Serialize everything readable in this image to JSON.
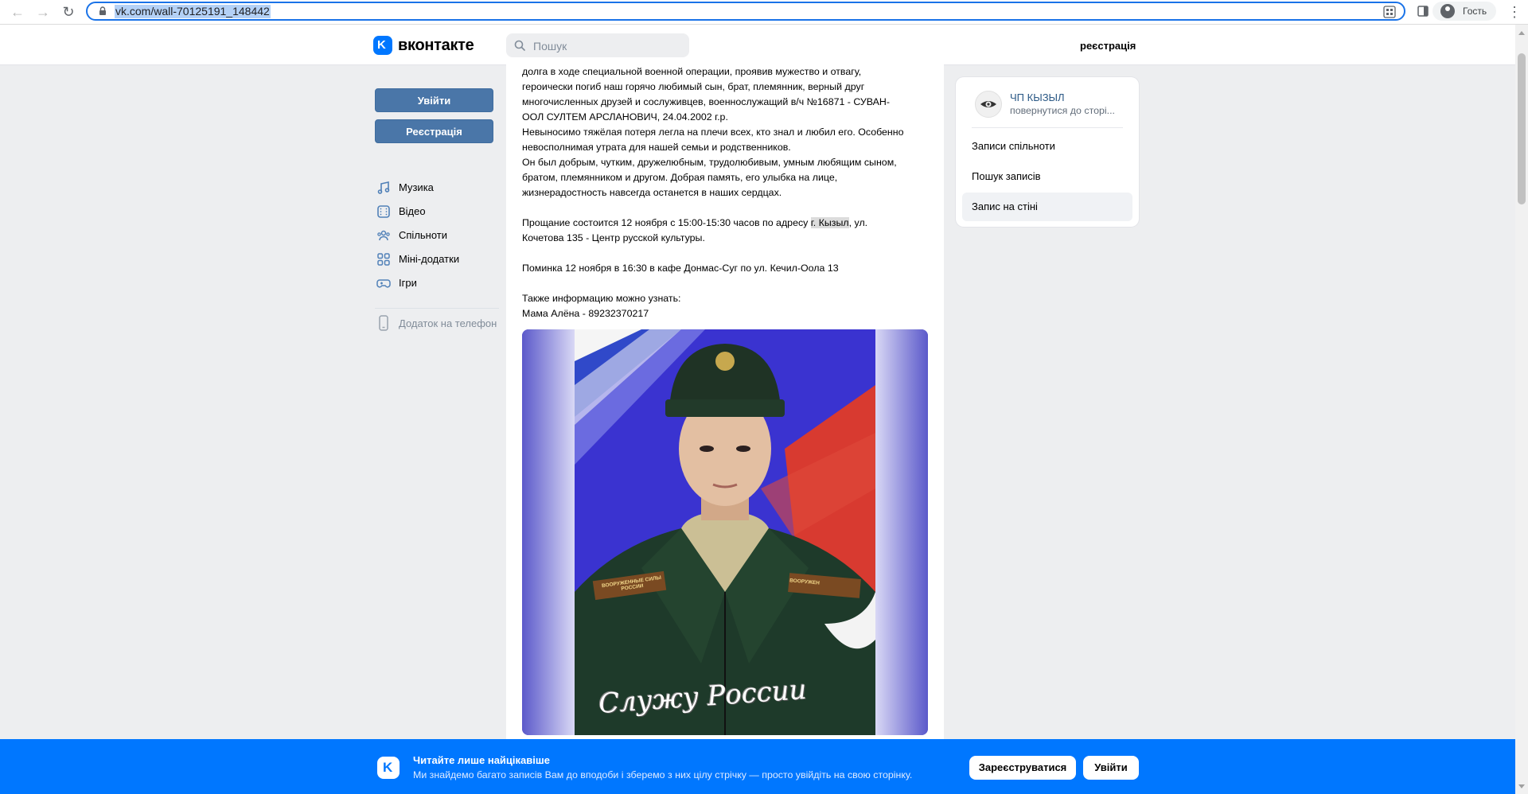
{
  "browser": {
    "url": "vk.com/wall-70125191_148442",
    "profile_label": "Гость"
  },
  "header": {
    "logo_text": "вконтакте",
    "search_placeholder": "Пошук",
    "register_label": "реєстрація"
  },
  "sidebar": {
    "login_label": "Увійти",
    "register_label": "Реєстрація",
    "items": [
      {
        "label": "Музика",
        "icon": "music-icon"
      },
      {
        "label": "Відео",
        "icon": "video-icon"
      },
      {
        "label": "Спільноти",
        "icon": "groups-icon"
      },
      {
        "label": "Міні-додатки",
        "icon": "apps-icon"
      },
      {
        "label": "Ігри",
        "icon": "games-icon"
      }
    ],
    "phone_app_label": "Додаток на телефон"
  },
  "post": {
    "paragraphs": [
      "долга в ходе специальной военной операции, проявив мужество и отвагу,",
      "героически погиб наш горячо любимый сын, брат, племянник, верный друг",
      "многочисленных друзей и сослуживцев, военнослужащий в/ч №16871 - СУВАН-",
      "ООЛ СУЛТЕМ АРСЛАНОВИЧ, 24.04.2002 г.р.",
      "Невыносимо тяжёлая потеря легла на плечи всех, кто знал и любил его. Особенно",
      "невосполнимая утрата для нашей семьи и родственников.",
      "Он был добрым, чутким, дружелюбным, трудолюбивым, умным любящим сыном,",
      "братом, племянником и другом. Добрая память, его улыбка на лице,",
      "жизнерадостность навсегда останется в наших сердцах."
    ],
    "farewell_prefix": "Прощание состоится 12 ноября с 15:00-15:30 часов по адресу ",
    "farewell_highlight": "г. Кызыл",
    "farewell_suffix": ", ул.",
    "farewell_line2": "Кочетова 135 - Центр русской культуры.",
    "wake": "Поминка 12 ноября в 16:30 в кафе Донмас-Суг по ул. Кечил-Оола 13",
    "info_line1": "Также информацию можно узнать:",
    "info_line2": "Мама Алёна - 89232370217",
    "photo": {
      "chevron_left": "ВООРУЖЕННЫЕ СИЛЫ РОССИИ",
      "chevron_right": "ВООРУЖЕН",
      "caption": "Служу России"
    }
  },
  "right_panel": {
    "group_name": "ЧП КЫЗЫЛ",
    "group_sub": "повернутися до сторі...",
    "links": [
      "Записи спільноти",
      "Пошук записів",
      "Запис на стіні"
    ]
  },
  "banner": {
    "title": "Читайте лише найцікавіше",
    "subtitle": "Ми знайдемо багато записів Вам до вподоби і зберемо з них цілу стрічку — просто увійдіть на свою сторінку.",
    "register_label": "Зареєструватися",
    "login_label": "Увійти"
  },
  "colors": {
    "vk_blue": "#0077ff",
    "button_blue": "#4a76a8",
    "link_blue": "#2a5885"
  }
}
